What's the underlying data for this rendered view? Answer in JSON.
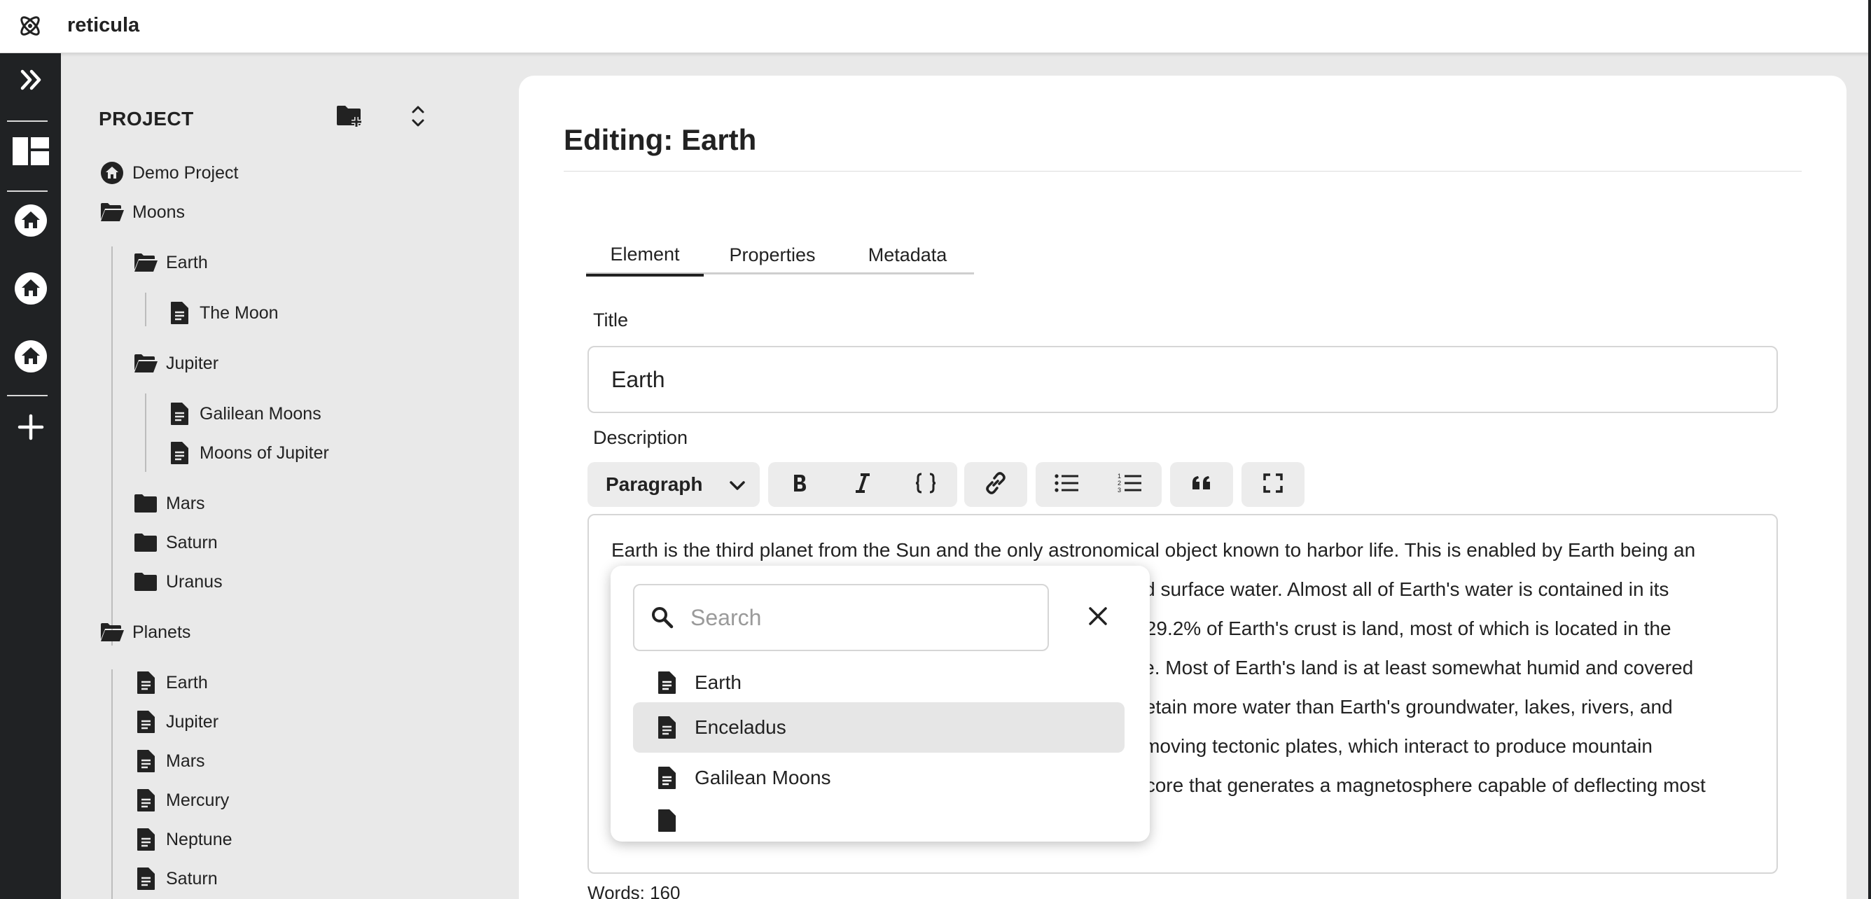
{
  "app": {
    "title": "reticula",
    "logo_icon": "atom-icon"
  },
  "rail": {
    "items": [
      {
        "name": "expand-sidebar-icon"
      },
      {
        "name": "dashboard-icon"
      },
      {
        "name": "project-home-icon"
      },
      {
        "name": "project-home-icon"
      },
      {
        "name": "project-home-icon"
      },
      {
        "name": "add-icon"
      }
    ]
  },
  "tree": {
    "header": "PROJECT",
    "items": [
      {
        "label": "Demo Project",
        "icon": "home-icon"
      },
      {
        "label": "Moons",
        "icon": "folder-open-icon"
      },
      {
        "label": "Earth",
        "icon": "folder-open-icon"
      },
      {
        "label": "The Moon",
        "icon": "document-icon"
      },
      {
        "label": "Jupiter",
        "icon": "folder-open-icon"
      },
      {
        "label": "Galilean Moons",
        "icon": "document-icon"
      },
      {
        "label": "Moons of Jupiter",
        "icon": "document-icon"
      },
      {
        "label": "Mars",
        "icon": "folder-icon"
      },
      {
        "label": "Saturn",
        "icon": "folder-icon"
      },
      {
        "label": "Uranus",
        "icon": "folder-icon"
      },
      {
        "label": "Planets",
        "icon": "folder-open-icon"
      },
      {
        "label": "Earth",
        "icon": "document-icon"
      },
      {
        "label": "Jupiter",
        "icon": "document-icon"
      },
      {
        "label": "Mars",
        "icon": "document-icon"
      },
      {
        "label": "Mercury",
        "icon": "document-icon"
      },
      {
        "label": "Neptune",
        "icon": "document-icon"
      },
      {
        "label": "Saturn",
        "icon": "document-icon"
      }
    ]
  },
  "editor": {
    "title": "Editing: Earth",
    "tabs": [
      "Element",
      "Properties",
      "Metadata"
    ],
    "active_tab": "Element",
    "title_label": "Title",
    "title_value": "Earth",
    "description_label": "Description",
    "block_type": "Paragraph",
    "description_lines": [
      "Earth is the third planet from the Sun and the only astronomical object known to harbor life. This is enabled by Earth being an",
      "ocean world, the only one in the Solar System sustaining liquid surface water. Almost all of Earth's water is contained in its",
      "global ocean, covering 70.8% of Earth's crust. The remaining 29.2% of Earth's crust is land, most of which is located in the",
      "form of continental landmasses within Earth's land hemisphere. Most of Earth's land is at least somewhat humid and covered",
      "by vegetation, while large ice sheets at Earth's polar deserts retain more water than Earth's groundwater, lakes, rivers, and",
      "atmospheric water combined. Earth's crust consists of slowly moving tectonic plates, which interact to produce mountain",
      "ranges, volcanoes, and earthquakes. Earth has a liquid outer core that generates a magnetosphere capable of deflecting most"
    ],
    "word_count": "Words: 160"
  },
  "link_popup": {
    "search_placeholder": "Search",
    "results": [
      {
        "label": "Earth",
        "highlighted": false
      },
      {
        "label": "Enceladus",
        "highlighted": true
      },
      {
        "label": "Galilean Moons",
        "highlighted": false
      }
    ]
  }
}
